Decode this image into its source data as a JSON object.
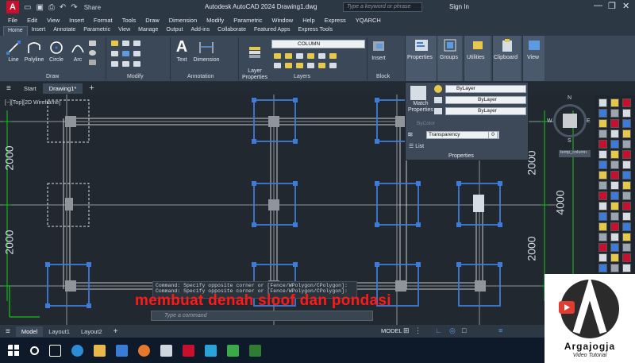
{
  "app": {
    "logo_letter": "A",
    "share_label": "Share",
    "window_title": "Autodesk AutoCAD 2024   Drawing1.dwg",
    "search_placeholder": "Type a keyword or phrase",
    "sign_in": "Sign In"
  },
  "menu": [
    "File",
    "Edit",
    "View",
    "Insert",
    "Format",
    "Tools",
    "Draw",
    "Dimension",
    "Modify",
    "Parametric",
    "Window",
    "Help",
    "Express",
    "YQARCH"
  ],
  "ribbon_tabs": [
    "Home",
    "Insert",
    "Annotate",
    "Parametric",
    "View",
    "Manage",
    "Output",
    "Add-ins",
    "Collaborate",
    "Featured Apps",
    "Express Tools"
  ],
  "ribbon": {
    "draw_tools": [
      "Line",
      "Polyline",
      "Circle",
      "Arc"
    ],
    "draw_label": "Draw",
    "modify_label": "Modify",
    "annotation_tools": [
      "Text",
      "Dimension"
    ],
    "annotation_label": "Annotation",
    "layer_properties": "Layer\nProperties",
    "layer_current": "COLUMN",
    "layers_label": "Layers",
    "insert": "Insert",
    "block_label": "Block",
    "properties": "Properties",
    "groups": "Groups",
    "utilities": "Utilities",
    "clipboard": "Clipboard",
    "view": "View"
  },
  "properties_panel": {
    "match_properties": "Match\nProperties",
    "color": "ByLayer",
    "linetype": "ByLayer",
    "lineweight": "ByLayer",
    "plotstyle": "ByColor",
    "transparency_label": "Transparency",
    "transparency_value": "0",
    "list": "List",
    "title": "Properties"
  },
  "doc_tabs": {
    "start": "Start",
    "drawing": "Drawing1*"
  },
  "viewport_label": "[−][Top][2D Wireframe]",
  "dimensions": {
    "left_top": "2000",
    "left_bottom": "2000",
    "right_top": "2000",
    "right_mid": "4000",
    "right_bottom": "2000"
  },
  "viewcube": {
    "N": "N",
    "W": "W",
    "E": "E",
    "S": "S",
    "ucs": "temp_column"
  },
  "command": {
    "history": [
      "Command: Specify opposite corner or [Fence/WPolygon/CPolygon]:",
      "Command: Specify opposite corner or [Fence/WPolygon/CPolygon]:"
    ],
    "placeholder": "Type a command"
  },
  "caption": "membuat denah sloof dan pondasi",
  "status": {
    "model": "Model",
    "layout1": "Layout1",
    "layout2": "Layout2",
    "model_right": "MODEL"
  },
  "watermark": {
    "name": "Argajogja",
    "subtitle": "Video Tutorial"
  },
  "colors": {
    "accent_blue": "#3d7bd8",
    "green_axis": "#16c416",
    "grid_gray": "#8f959b",
    "red_caption": "#ff1a1a",
    "autocad_red": "#c8102e"
  }
}
